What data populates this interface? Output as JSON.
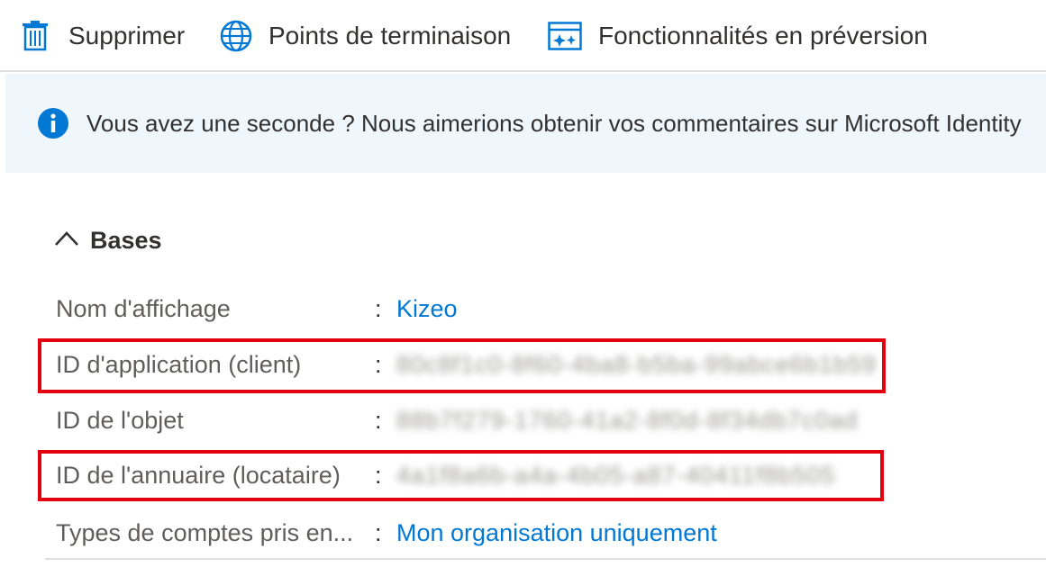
{
  "toolbar": {
    "delete_label": "Supprimer",
    "endpoints_label": "Points de terminaison",
    "preview_label": "Fonctionnalités en préversion"
  },
  "banner": {
    "message": "Vous avez une seconde ? Nous aimerions obtenir vos commentaires sur Microsoft Identity"
  },
  "section": {
    "title": "Bases"
  },
  "properties": [
    {
      "label": "Nom d'affichage",
      "colon": ":",
      "value": "Kizeo"
    },
    {
      "label": "ID d'application (client)",
      "colon": ":",
      "value": "80c8f1c0-8f60-4ba8-b5ba-99abce6b1b59"
    },
    {
      "label": "ID de l'objet",
      "colon": ":",
      "value": "88b7f279-1760-41a2-8f0d-8f34db7c0ad"
    },
    {
      "label": "ID de l'annuaire (locataire)",
      "colon": ":",
      "value": "4a1f8a6b-a4a-4b05-a87-40411f8b505"
    },
    {
      "label": "Types de comptes pris en...",
      "colon": ":",
      "value": "Mon organisation uniquement"
    }
  ],
  "colors": {
    "accent": "#0078d4",
    "banner_bg": "#eff6fc",
    "highlight": "#e3000f"
  }
}
